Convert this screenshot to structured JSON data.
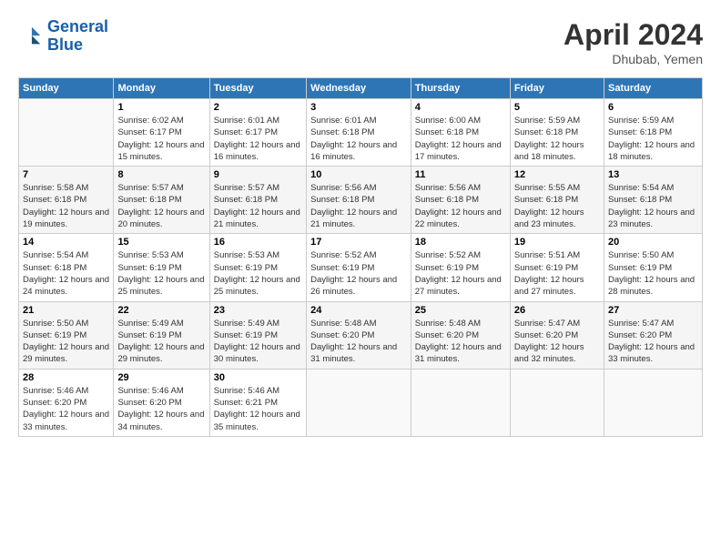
{
  "logo": {
    "line1": "General",
    "line2": "Blue"
  },
  "title": "April 2024",
  "subtitle": "Dhubab, Yemen",
  "headers": [
    "Sunday",
    "Monday",
    "Tuesday",
    "Wednesday",
    "Thursday",
    "Friday",
    "Saturday"
  ],
  "weeks": [
    [
      {
        "day": "",
        "sunrise": "",
        "sunset": "",
        "daylight": ""
      },
      {
        "day": "1",
        "sunrise": "Sunrise: 6:02 AM",
        "sunset": "Sunset: 6:17 PM",
        "daylight": "Daylight: 12 hours and 15 minutes."
      },
      {
        "day": "2",
        "sunrise": "Sunrise: 6:01 AM",
        "sunset": "Sunset: 6:17 PM",
        "daylight": "Daylight: 12 hours and 16 minutes."
      },
      {
        "day": "3",
        "sunrise": "Sunrise: 6:01 AM",
        "sunset": "Sunset: 6:18 PM",
        "daylight": "Daylight: 12 hours and 16 minutes."
      },
      {
        "day": "4",
        "sunrise": "Sunrise: 6:00 AM",
        "sunset": "Sunset: 6:18 PM",
        "daylight": "Daylight: 12 hours and 17 minutes."
      },
      {
        "day": "5",
        "sunrise": "Sunrise: 5:59 AM",
        "sunset": "Sunset: 6:18 PM",
        "daylight": "Daylight: 12 hours and 18 minutes."
      },
      {
        "day": "6",
        "sunrise": "Sunrise: 5:59 AM",
        "sunset": "Sunset: 6:18 PM",
        "daylight": "Daylight: 12 hours and 18 minutes."
      }
    ],
    [
      {
        "day": "7",
        "sunrise": "Sunrise: 5:58 AM",
        "sunset": "Sunset: 6:18 PM",
        "daylight": "Daylight: 12 hours and 19 minutes."
      },
      {
        "day": "8",
        "sunrise": "Sunrise: 5:57 AM",
        "sunset": "Sunset: 6:18 PM",
        "daylight": "Daylight: 12 hours and 20 minutes."
      },
      {
        "day": "9",
        "sunrise": "Sunrise: 5:57 AM",
        "sunset": "Sunset: 6:18 PM",
        "daylight": "Daylight: 12 hours and 21 minutes."
      },
      {
        "day": "10",
        "sunrise": "Sunrise: 5:56 AM",
        "sunset": "Sunset: 6:18 PM",
        "daylight": "Daylight: 12 hours and 21 minutes."
      },
      {
        "day": "11",
        "sunrise": "Sunrise: 5:56 AM",
        "sunset": "Sunset: 6:18 PM",
        "daylight": "Daylight: 12 hours and 22 minutes."
      },
      {
        "day": "12",
        "sunrise": "Sunrise: 5:55 AM",
        "sunset": "Sunset: 6:18 PM",
        "daylight": "Daylight: 12 hours and 23 minutes."
      },
      {
        "day": "13",
        "sunrise": "Sunrise: 5:54 AM",
        "sunset": "Sunset: 6:18 PM",
        "daylight": "Daylight: 12 hours and 23 minutes."
      }
    ],
    [
      {
        "day": "14",
        "sunrise": "Sunrise: 5:54 AM",
        "sunset": "Sunset: 6:18 PM",
        "daylight": "Daylight: 12 hours and 24 minutes."
      },
      {
        "day": "15",
        "sunrise": "Sunrise: 5:53 AM",
        "sunset": "Sunset: 6:19 PM",
        "daylight": "Daylight: 12 hours and 25 minutes."
      },
      {
        "day": "16",
        "sunrise": "Sunrise: 5:53 AM",
        "sunset": "Sunset: 6:19 PM",
        "daylight": "Daylight: 12 hours and 25 minutes."
      },
      {
        "day": "17",
        "sunrise": "Sunrise: 5:52 AM",
        "sunset": "Sunset: 6:19 PM",
        "daylight": "Daylight: 12 hours and 26 minutes."
      },
      {
        "day": "18",
        "sunrise": "Sunrise: 5:52 AM",
        "sunset": "Sunset: 6:19 PM",
        "daylight": "Daylight: 12 hours and 27 minutes."
      },
      {
        "day": "19",
        "sunrise": "Sunrise: 5:51 AM",
        "sunset": "Sunset: 6:19 PM",
        "daylight": "Daylight: 12 hours and 27 minutes."
      },
      {
        "day": "20",
        "sunrise": "Sunrise: 5:50 AM",
        "sunset": "Sunset: 6:19 PM",
        "daylight": "Daylight: 12 hours and 28 minutes."
      }
    ],
    [
      {
        "day": "21",
        "sunrise": "Sunrise: 5:50 AM",
        "sunset": "Sunset: 6:19 PM",
        "daylight": "Daylight: 12 hours and 29 minutes."
      },
      {
        "day": "22",
        "sunrise": "Sunrise: 5:49 AM",
        "sunset": "Sunset: 6:19 PM",
        "daylight": "Daylight: 12 hours and 29 minutes."
      },
      {
        "day": "23",
        "sunrise": "Sunrise: 5:49 AM",
        "sunset": "Sunset: 6:19 PM",
        "daylight": "Daylight: 12 hours and 30 minutes."
      },
      {
        "day": "24",
        "sunrise": "Sunrise: 5:48 AM",
        "sunset": "Sunset: 6:20 PM",
        "daylight": "Daylight: 12 hours and 31 minutes."
      },
      {
        "day": "25",
        "sunrise": "Sunrise: 5:48 AM",
        "sunset": "Sunset: 6:20 PM",
        "daylight": "Daylight: 12 hours and 31 minutes."
      },
      {
        "day": "26",
        "sunrise": "Sunrise: 5:47 AM",
        "sunset": "Sunset: 6:20 PM",
        "daylight": "Daylight: 12 hours and 32 minutes."
      },
      {
        "day": "27",
        "sunrise": "Sunrise: 5:47 AM",
        "sunset": "Sunset: 6:20 PM",
        "daylight": "Daylight: 12 hours and 33 minutes."
      }
    ],
    [
      {
        "day": "28",
        "sunrise": "Sunrise: 5:46 AM",
        "sunset": "Sunset: 6:20 PM",
        "daylight": "Daylight: 12 hours and 33 minutes."
      },
      {
        "day": "29",
        "sunrise": "Sunrise: 5:46 AM",
        "sunset": "Sunset: 6:20 PM",
        "daylight": "Daylight: 12 hours and 34 minutes."
      },
      {
        "day": "30",
        "sunrise": "Sunrise: 5:46 AM",
        "sunset": "Sunset: 6:21 PM",
        "daylight": "Daylight: 12 hours and 35 minutes."
      },
      {
        "day": "",
        "sunrise": "",
        "sunset": "",
        "daylight": ""
      },
      {
        "day": "",
        "sunrise": "",
        "sunset": "",
        "daylight": ""
      },
      {
        "day": "",
        "sunrise": "",
        "sunset": "",
        "daylight": ""
      },
      {
        "day": "",
        "sunrise": "",
        "sunset": "",
        "daylight": ""
      }
    ]
  ]
}
